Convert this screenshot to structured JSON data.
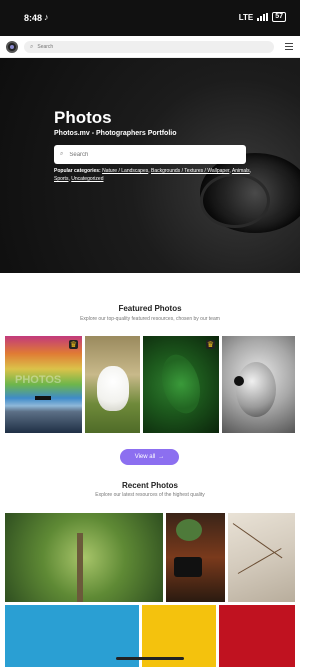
{
  "status_bar": {
    "time": "8:48",
    "network": "LTE",
    "battery": "57"
  },
  "nav": {
    "search_placeholder": "Search"
  },
  "hero": {
    "title": "Photos",
    "subtitle": "Photos.mv - Photographers Portfolio",
    "search_placeholder": "Search",
    "popular_label": "Popular categories:",
    "categories": [
      "Nature / Landscapes",
      "Backgrounds / Textures / Wallpaper",
      "Animals",
      "Sports",
      "Uncategorized"
    ]
  },
  "featured": {
    "title": "Featured Photos",
    "subtitle": "Explore our top-quality featured resources, chosen by our team",
    "view_all": "View all",
    "watermark": "PHOTOS"
  },
  "recent": {
    "title": "Recent Photos",
    "subtitle": "Explore our latest resources of the highest quality"
  },
  "colors": {
    "accent": "#8c6ff0",
    "hero_bg": "#111111"
  },
  "icons": [
    "search-icon",
    "menu-icon",
    "crown-icon",
    "arrow-right-icon"
  ]
}
